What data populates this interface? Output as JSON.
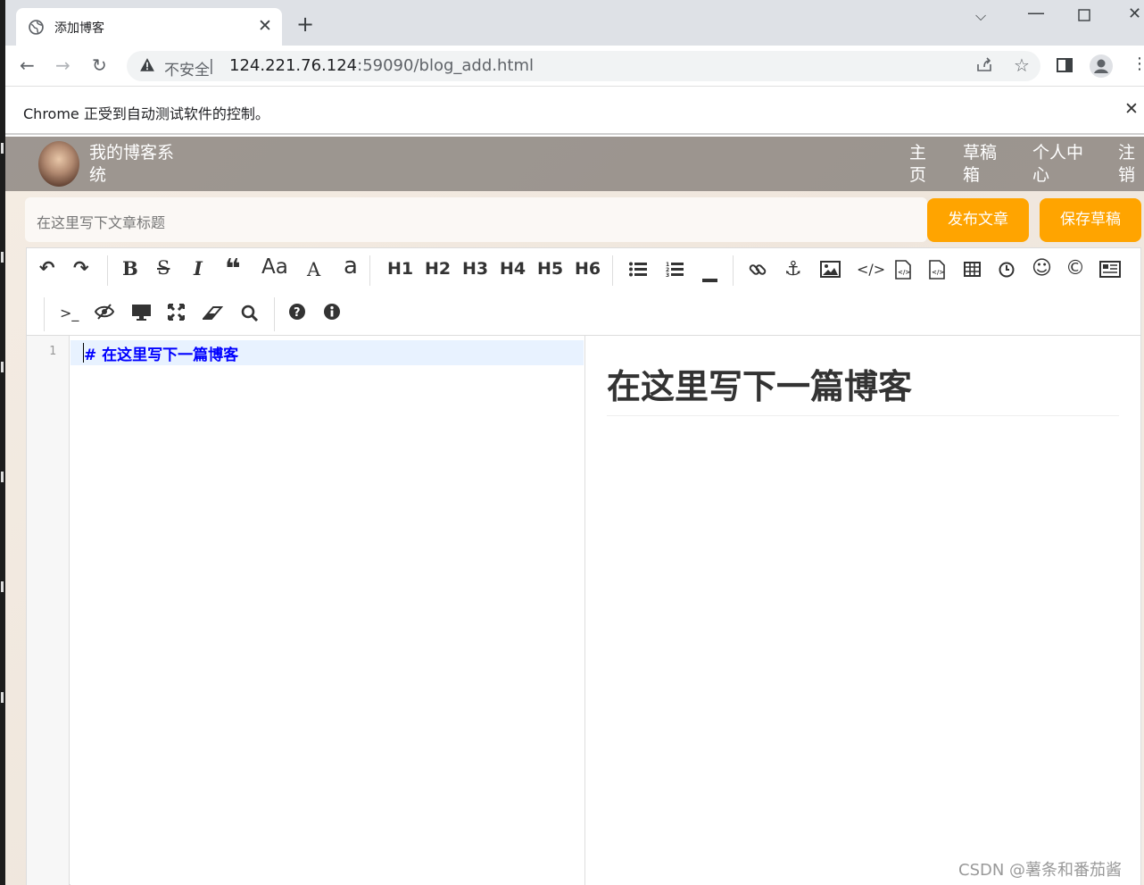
{
  "browser": {
    "tab_title": "添加博客",
    "tab_close": "✕",
    "new_tab": "+",
    "url_security": "不安全",
    "url_host": "124.221.76.124",
    "url_path": ":59090/blog_add.html",
    "infobar_message": "Chrome 正受到自动测试软件的控制。",
    "infobar_close": "✕"
  },
  "header": {
    "brand": "我的博客系统",
    "nav": [
      "主页",
      "草稿箱",
      "个人中心",
      "注销"
    ]
  },
  "editor_bar": {
    "title_placeholder": "在这里写下文章标题",
    "publish_label": "发布文章",
    "save_draft_label": "保存草稿"
  },
  "toolbar": {
    "headings": [
      "H1",
      "H2",
      "H3",
      "H4",
      "H5",
      "H6"
    ],
    "aa_upper": "Aa",
    "a_upper": "A",
    "a_lower": "a"
  },
  "markdown": {
    "line_number": "1",
    "source": "#  在这里写下一篇博客",
    "preview_heading": "在这里写下一篇博客"
  },
  "watermark": "CSDN @薯条和番茄酱",
  "colors": {
    "accent_button": "#ffa400",
    "header_bg": "#78726e",
    "code_text": "#0000ff"
  }
}
